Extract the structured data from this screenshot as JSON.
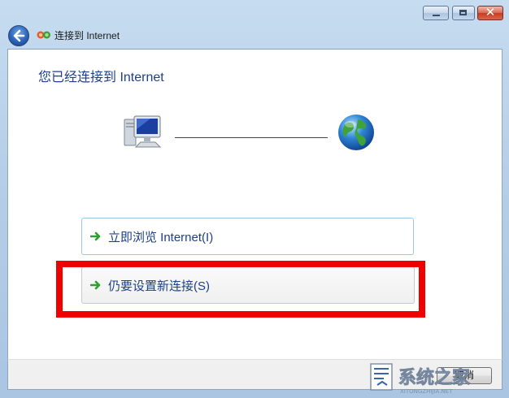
{
  "window": {
    "title": "连接到 Internet",
    "close_glyph": "✕"
  },
  "content": {
    "heading": "您已经连接到 Internet",
    "options": [
      {
        "label": "立即浏览 Internet(I)",
        "icon": "green-arrow-icon"
      },
      {
        "label": "仍要设置新连接(S)",
        "icon": "green-arrow-icon"
      }
    ]
  },
  "footer": {
    "cancel_label": "取消"
  },
  "watermark": {
    "text": "系统之家"
  },
  "colors": {
    "heading": "#1e3f8a",
    "highlight": "#ee0000",
    "arrow": "#2ea02e"
  }
}
